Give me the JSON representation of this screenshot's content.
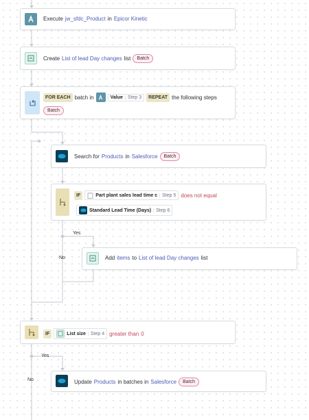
{
  "steps": {
    "execute": {
      "prefix": "Execute",
      "target": "jw_sfdc_Product",
      "mid": "in",
      "app": "Epicor Kinetic"
    },
    "create": {
      "prefix": "Create",
      "target": "List of lead Day changes",
      "suffix": "list",
      "badge": "Batch"
    },
    "foreach": {
      "kw1": "FOR EACH",
      "t1": "batch in",
      "chip_label": "Value",
      "chip_step": "Step 3",
      "kw2": "REPEAT",
      "t2": "the following steps",
      "badge": "Batch"
    },
    "search": {
      "prefix": "Search for",
      "object": "Products",
      "mid": "in",
      "app": "Salesforce",
      "badge": "Batch"
    },
    "if1": {
      "kw": "IF",
      "chip1_label": "Part plant sales lead time c",
      "chip1_step": "Step 5",
      "op": "does not equal",
      "chip2_label": "Standard Lead Time (Days)",
      "chip2_step": "Step 6"
    },
    "add": {
      "prefix": "Add",
      "item": "items",
      "mid": "to",
      "list": "List of lead Day changes",
      "suffix": "list"
    },
    "if2": {
      "kw": "IF",
      "chip_label": "List size",
      "chip_step": "Step 4",
      "op": "greater than",
      "value": "0"
    },
    "update": {
      "prefix": "Update",
      "object": "Products",
      "mid": "in batches in",
      "app": "Salesforce",
      "badge": "Batch"
    }
  },
  "branches": {
    "yes": "Yes",
    "no": "No"
  },
  "colors": {
    "connector": "#c5cad1",
    "link": "#4b5bb6",
    "badge_border": "#e08aa4",
    "keyword_bg": "#ece6c9",
    "salesforce_icon_bg": "#0c3f55",
    "kinetic_icon_bg": "#5e95a8",
    "condition_red": "#c4475c"
  },
  "icons": {
    "execute": "kinetic-icon",
    "create": "list-icon",
    "foreach": "loop-icon",
    "search": "salesforce-icon",
    "if": "branch-icon",
    "add": "list-icon",
    "update": "salesforce-icon"
  }
}
